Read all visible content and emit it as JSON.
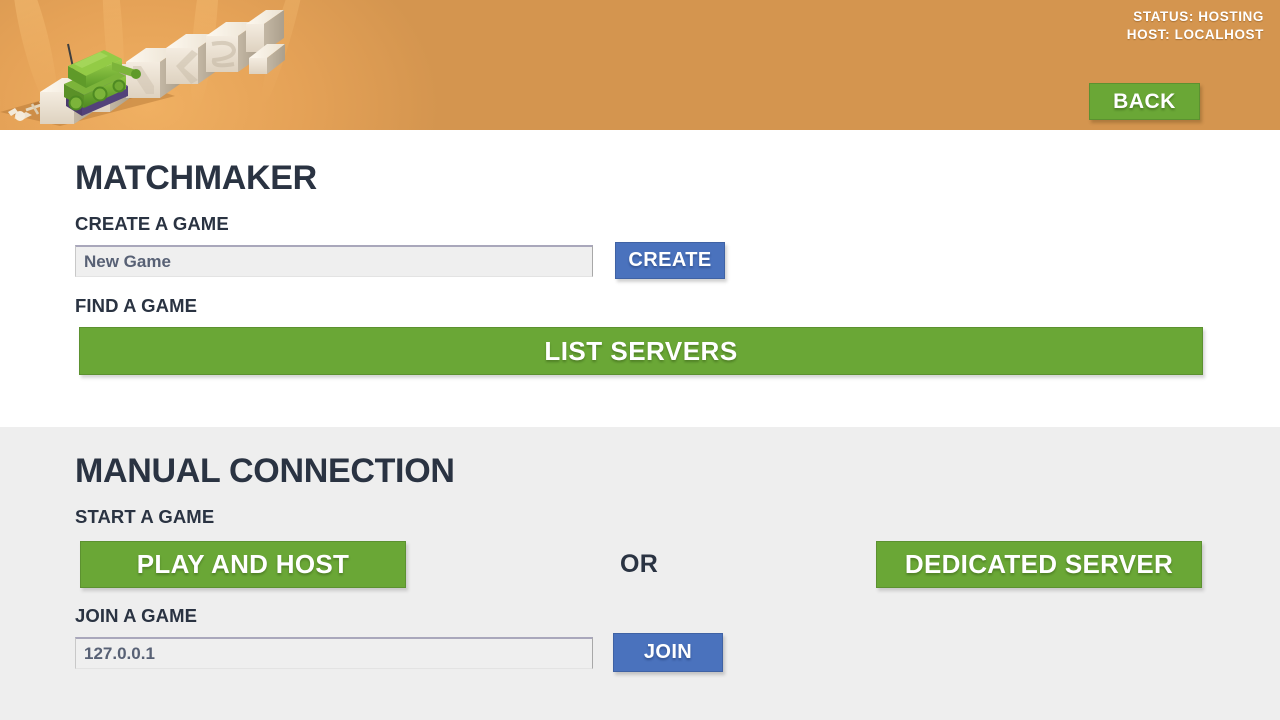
{
  "header": {
    "logo_alt": "TANKS!",
    "status_lines": [
      "STATUS: HOSTING",
      "HOST: LOCALHOST"
    ],
    "back_label": "BACK",
    "background_color": "#d4954f"
  },
  "matchmaker": {
    "title": "MATCHMAKER",
    "create_label": "CREATE A GAME",
    "game_name_value": "New Game",
    "game_name_placeholder": "New Game",
    "create_button": "CREATE",
    "find_label": "FIND A GAME",
    "list_servers_button": "LIST SERVERS"
  },
  "manual": {
    "title": "MANUAL CONNECTION",
    "start_label": "START A GAME",
    "play_and_host_button": "PLAY AND HOST",
    "or_label": "OR",
    "dedicated_server_button": "DEDICATED SERVER",
    "join_label": "JOIN A GAME",
    "address_value": "127.0.0.1",
    "address_placeholder": "127.0.0.1",
    "join_button": "JOIN"
  },
  "colors": {
    "accent_green": "#6aa736",
    "accent_blue": "#4a72bd",
    "header_orange": "#d4954f",
    "text_dark": "#2a3342",
    "panel_gray": "#eeeeee"
  }
}
